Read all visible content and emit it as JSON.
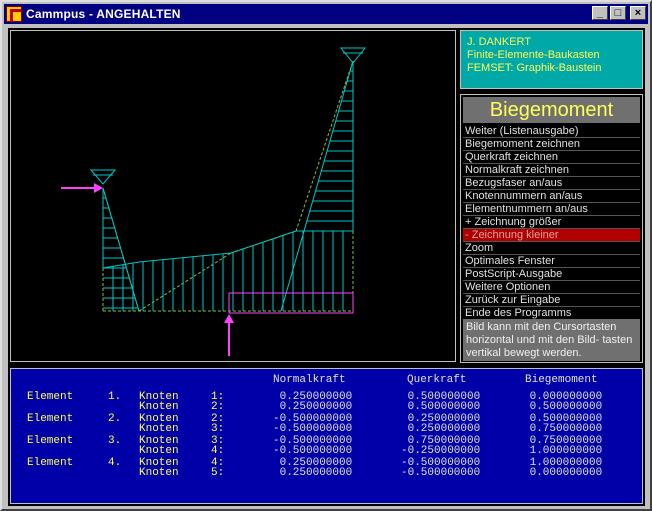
{
  "window": {
    "title": "Cammpus - ANGEHALTEN",
    "min": "_",
    "max": "□",
    "close": "×"
  },
  "info": {
    "line1": "J. DANKERT",
    "line2": "Finite-Elemente-Baukasten",
    "line3": "FEMSET:  Graphik-Baustein"
  },
  "menu": {
    "title": "Biegemoment",
    "items": [
      "Weiter (Listenausgabe)",
      "Biegemoment zeichnen",
      "Querkraft zeichnen",
      "Normalkraft zeichnen",
      "Bezugsfaser an/aus",
      "Knotennummern  an/aus",
      "Elementnummern an/aus",
      "+ Zeichnung größer",
      "- Zeichnung kleiner",
      "Zoom",
      "Optimales Fenster",
      "PostScript-Ausgabe",
      "Weitere Optionen",
      "Zurück zur Eingabe",
      "Ende des Programms"
    ],
    "selected_index": 8,
    "hint": "Bild kann mit den Cursortasten horizontal und mit den Bild- tasten vertikal bewegt werden."
  },
  "table": {
    "headers": {
      "normal": "Normalkraft",
      "quer": "Querkraft",
      "biege": "Biegemoment"
    },
    "rows": [
      {
        "el": "Element",
        "nr": "1.",
        "kn": "Knoten",
        "knr": "1:",
        "n": " 0.250000000",
        "q": " 0.500000000",
        "m": " 0.000000000"
      },
      {
        "el": "",
        "nr": "",
        "kn": "Knoten",
        "knr": "2:",
        "n": " 0.250000000",
        "q": " 0.500000000",
        "m": " 0.500000000"
      },
      {
        "el": "Element",
        "nr": "2.",
        "kn": "Knoten",
        "knr": "2:",
        "n": "-0.500000000",
        "q": " 0.250000000",
        "m": " 0.500000000"
      },
      {
        "el": "",
        "nr": "",
        "kn": "Knoten",
        "knr": "3:",
        "n": "-0.500000000",
        "q": " 0.250000000",
        "m": " 0.750000000"
      },
      {
        "el": "Element",
        "nr": "3.",
        "kn": "Knoten",
        "knr": "3:",
        "n": "-0.500000000",
        "q": " 0.750000000",
        "m": " 0.750000000"
      },
      {
        "el": "",
        "nr": "",
        "kn": "Knoten",
        "knr": "4:",
        "n": "-0.500000000",
        "q": "-0.250000000",
        "m": " 1.000000000"
      },
      {
        "el": "Element",
        "nr": "4.",
        "kn": "Knoten",
        "knr": "4:",
        "n": " 0.250000000",
        "q": "-0.500000000",
        "m": " 1.000000000"
      },
      {
        "el": "",
        "nr": "",
        "kn": "Knoten",
        "knr": "5:",
        "n": " 0.250000000",
        "q": "-0.500000000",
        "m": " 0.000000000"
      }
    ]
  },
  "colors": {
    "accent_cyan": "#00c8c8",
    "structure_green": "#80c040",
    "load_magenta": "#ff40ff",
    "menu_highlight": "#b00000",
    "table_bg": "#0000a8",
    "info_bg": "#00a8a8"
  }
}
